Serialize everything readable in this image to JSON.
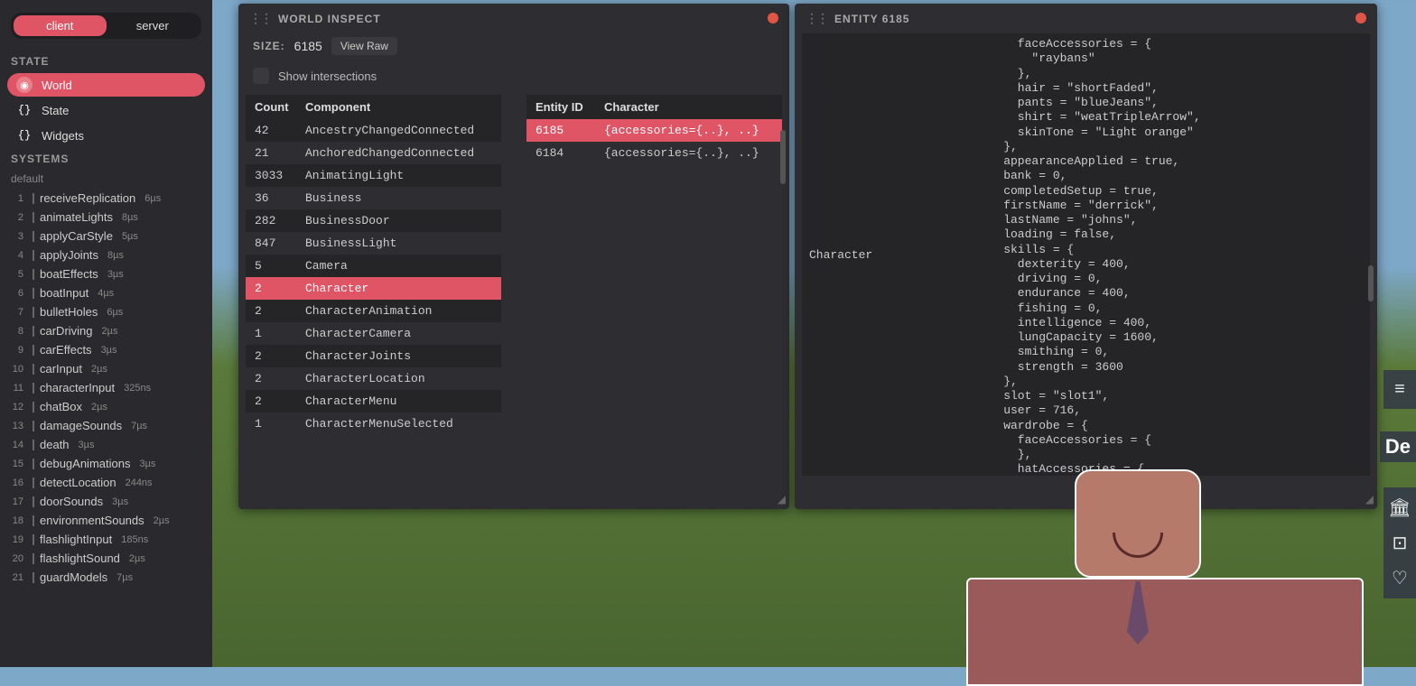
{
  "tabs": {
    "client": "client",
    "server": "server"
  },
  "stateHeader": "STATE",
  "stateItems": [
    {
      "label": "World",
      "active": true,
      "icon": "globe"
    },
    {
      "label": "State",
      "active": false,
      "icon": "braces"
    },
    {
      "label": "Widgets",
      "active": false,
      "icon": "braces"
    }
  ],
  "systemsHeader": "SYSTEMS",
  "systemsSub": "default",
  "systems": [
    {
      "n": "1",
      "name": "receiveReplication",
      "time": "6µs"
    },
    {
      "n": "2",
      "name": "animateLights",
      "time": "8µs"
    },
    {
      "n": "3",
      "name": "applyCarStyle",
      "time": "5µs"
    },
    {
      "n": "4",
      "name": "applyJoints",
      "time": "8µs"
    },
    {
      "n": "5",
      "name": "boatEffects",
      "time": "3µs"
    },
    {
      "n": "6",
      "name": "boatInput",
      "time": "4µs"
    },
    {
      "n": "7",
      "name": "bulletHoles",
      "time": "6µs"
    },
    {
      "n": "8",
      "name": "carDriving",
      "time": "2µs"
    },
    {
      "n": "9",
      "name": "carEffects",
      "time": "3µs"
    },
    {
      "n": "10",
      "name": "carInput",
      "time": "2µs"
    },
    {
      "n": "11",
      "name": "characterInput",
      "time": "325ns"
    },
    {
      "n": "12",
      "name": "chatBox",
      "time": "2µs"
    },
    {
      "n": "13",
      "name": "damageSounds",
      "time": "7µs"
    },
    {
      "n": "14",
      "name": "death",
      "time": "3µs"
    },
    {
      "n": "15",
      "name": "debugAnimations",
      "time": "3µs"
    },
    {
      "n": "16",
      "name": "detectLocation",
      "time": "244ns"
    },
    {
      "n": "17",
      "name": "doorSounds",
      "time": "3µs"
    },
    {
      "n": "18",
      "name": "environmentSounds",
      "time": "2µs"
    },
    {
      "n": "19",
      "name": "flashlightInput",
      "time": "185ns"
    },
    {
      "n": "20",
      "name": "flashlightSound",
      "time": "2µs"
    },
    {
      "n": "21",
      "name": "guardModels",
      "time": "7µs"
    }
  ],
  "world": {
    "title": "WORLD INSPECT",
    "sizeLabel": "SIZE:",
    "sizeValue": "6185",
    "viewRaw": "View Raw",
    "showIntersections": "Show intersections",
    "compHdr1": "Count",
    "compHdr2": "Component",
    "components": [
      {
        "count": "42",
        "name": "AncestryChangedConnected"
      },
      {
        "count": "21",
        "name": "AnchoredChangedConnected"
      },
      {
        "count": "3033",
        "name": "AnimatingLight"
      },
      {
        "count": "36",
        "name": "Business"
      },
      {
        "count": "282",
        "name": "BusinessDoor"
      },
      {
        "count": "847",
        "name": "BusinessLight"
      },
      {
        "count": "5",
        "name": "Camera"
      },
      {
        "count": "2",
        "name": "Character",
        "selected": true
      },
      {
        "count": "2",
        "name": "CharacterAnimation"
      },
      {
        "count": "1",
        "name": "CharacterCamera"
      },
      {
        "count": "2",
        "name": "CharacterJoints"
      },
      {
        "count": "2",
        "name": "CharacterLocation"
      },
      {
        "count": "2",
        "name": "CharacterMenu"
      },
      {
        "count": "1",
        "name": "CharacterMenuSelected"
      }
    ],
    "entHdr1": "Entity ID",
    "entHdr2": "Character",
    "entities": [
      {
        "id": "6185",
        "val": "{accessories={..}, ..}",
        "selected": true
      },
      {
        "id": "6184",
        "val": "{accessories={..}, ..}"
      }
    ]
  },
  "entity": {
    "title": "ENTITY 6185",
    "label": "Character",
    "code": "      faceAccessories = {\n        \"raybans\"\n      },\n      hair = \"shortFaded\",\n      pants = \"blueJeans\",\n      shirt = \"weatTripleArrow\",\n      skinTone = \"Light orange\"\n    },\n    appearanceApplied = true,\n    bank = 0,\n    completedSetup = true,\n    firstName = \"derrick\",\n    lastName = \"johns\",\n    loading = false,\n    skills = {\n      dexterity = 400,\n      driving = 0,\n      endurance = 400,\n      fishing = 0,\n      intelligence = 400,\n      lungCapacity = 1600,\n      smithing = 0,\n      strength = 3600\n    },\n    slot = \"slot1\",\n    user = 716,\n    wardrobe = {\n      faceAccessories = {\n      },\n      hatAccessories = {\n      }"
  },
  "deBadge": "De",
  "rightIcons": [
    "≡",
    "🏛",
    "⊡",
    "♡"
  ]
}
